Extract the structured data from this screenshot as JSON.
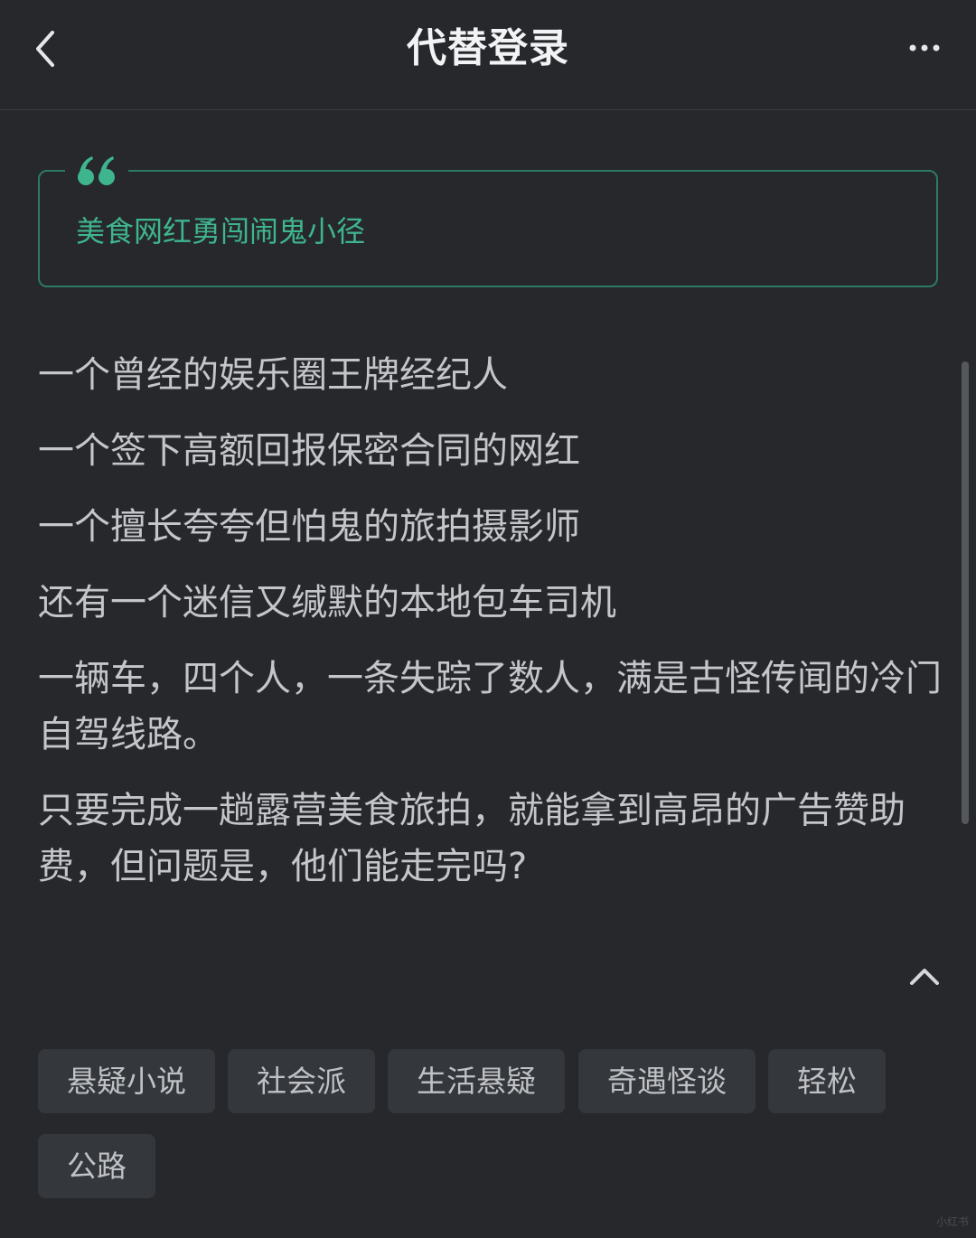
{
  "nav": {
    "title": "代替登录"
  },
  "quote": {
    "text": "美食网红勇闯闹鬼小径"
  },
  "description": [
    "一个曾经的娱乐圈王牌经纪人",
    "一个签下高额回报保密合同的网红",
    "一个擅长夸夸但怕鬼的旅拍摄影师",
    "还有一个迷信又缄默的本地包车司机",
    "一辆车，四个人，一条失踪了数人，满是古怪传闻的冷门自驾线路。",
    "只要完成一趟露营美食旅拍，就能拿到高昂的广告赞助费，但问题是，他们能走完吗?"
  ],
  "tags": [
    "悬疑小说",
    "社会派",
    "生活悬疑",
    "奇遇怪谈",
    "轻松",
    "公路"
  ],
  "watermark": "小红书",
  "colors": {
    "background": "#26282b",
    "accent": "#3fb58e",
    "border": "#2d7a62",
    "tag_bg": "#34373b"
  }
}
